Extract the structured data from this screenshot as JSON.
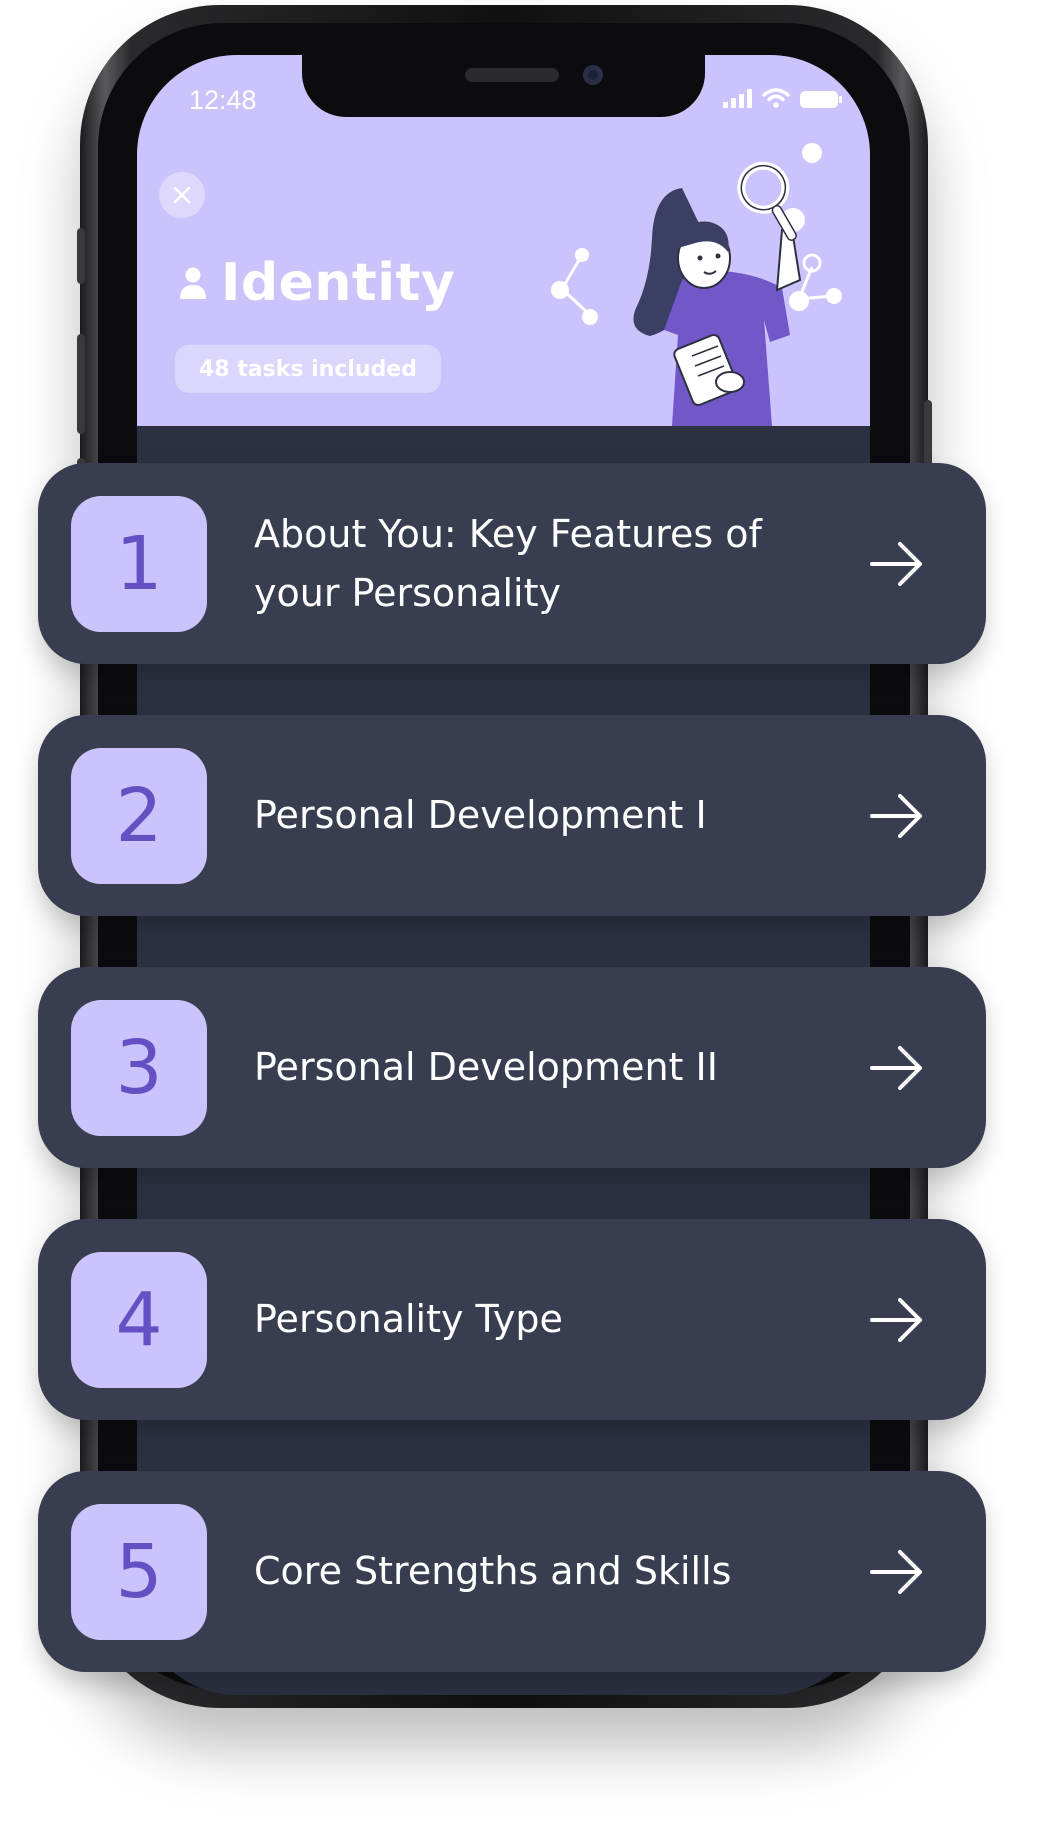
{
  "status_bar": {
    "time": "12:48"
  },
  "header": {
    "title": "Identity",
    "tasks_badge": "48 tasks included"
  },
  "colors": {
    "header_bg": "#cbc3fb",
    "card_bg": "#383e4f",
    "screen_bg": "#2c3142",
    "number_text": "#6450c2",
    "accent_purple": "#7a5fd0"
  },
  "tasks": [
    {
      "number": "1",
      "label": "About You: Key Features of your Personality"
    },
    {
      "number": "2",
      "label": "Personal Development I"
    },
    {
      "number": "3",
      "label": "Personal Development II"
    },
    {
      "number": "4",
      "label": "Personality Type"
    },
    {
      "number": "5",
      "label": "Core Strengths and Skills"
    }
  ]
}
